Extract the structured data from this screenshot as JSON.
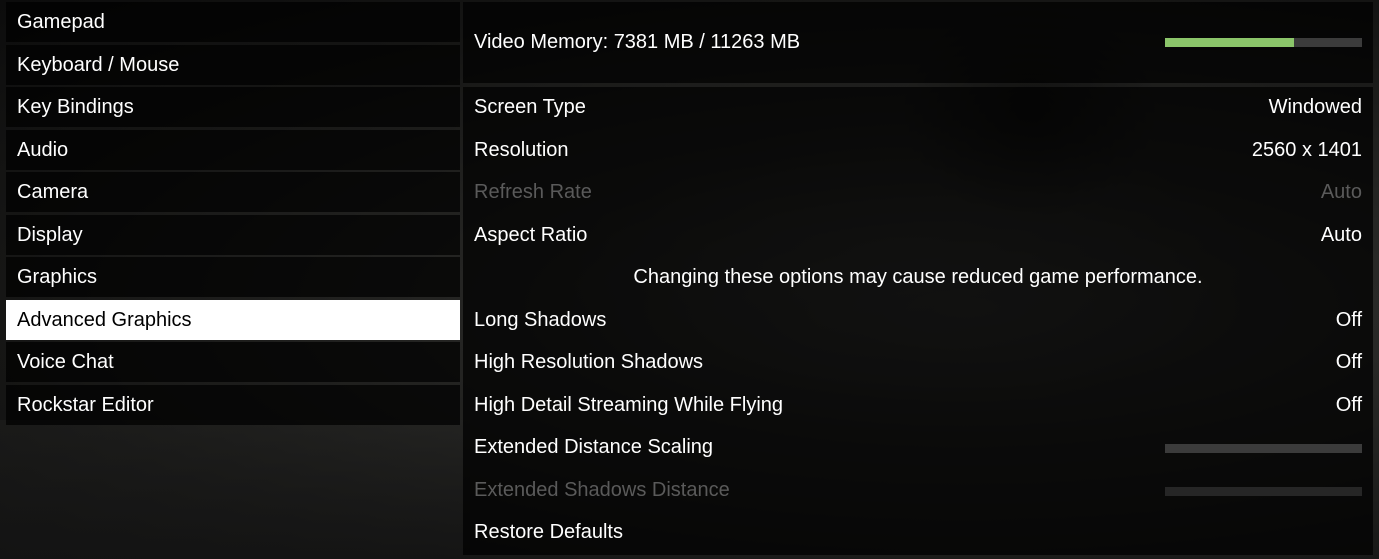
{
  "menu": {
    "items": [
      {
        "label": "Gamepad",
        "active": false
      },
      {
        "label": "Keyboard / Mouse",
        "active": false
      },
      {
        "label": "Key Bindings",
        "active": false
      },
      {
        "label": "Audio",
        "active": false
      },
      {
        "label": "Camera",
        "active": false
      },
      {
        "label": "Display",
        "active": false
      },
      {
        "label": "Graphics",
        "active": false
      },
      {
        "label": "Advanced Graphics",
        "active": true
      },
      {
        "label": "Voice Chat",
        "active": false
      },
      {
        "label": "Rockstar Editor",
        "active": false
      }
    ]
  },
  "video_memory": {
    "label": "Video Memory: 7381 MB / 11263 MB",
    "used_mb": 7381,
    "total_mb": 11263,
    "usage_fraction": 0.655,
    "bar_color": "#8bc56a"
  },
  "settings": {
    "screen_type": {
      "label": "Screen Type",
      "value": "Windowed"
    },
    "resolution": {
      "label": "Resolution",
      "value": "2560 x 1401"
    },
    "refresh_rate": {
      "label": "Refresh Rate",
      "value": "Auto",
      "disabled": true
    },
    "aspect_ratio": {
      "label": "Aspect Ratio",
      "value": "Auto"
    },
    "notice": "Changing these options may cause reduced game performance.",
    "long_shadows": {
      "label": "Long Shadows",
      "value": "Off"
    },
    "high_res_shadows": {
      "label": "High Resolution Shadows",
      "value": "Off"
    },
    "high_detail_streaming": {
      "label": "High Detail Streaming While Flying",
      "value": "Off"
    },
    "extended_distance_scaling": {
      "label": "Extended Distance Scaling",
      "level": 0
    },
    "extended_shadows_distance": {
      "label": "Extended Shadows Distance",
      "level": 0,
      "disabled": true
    },
    "restore_defaults": {
      "label": "Restore Defaults"
    }
  }
}
